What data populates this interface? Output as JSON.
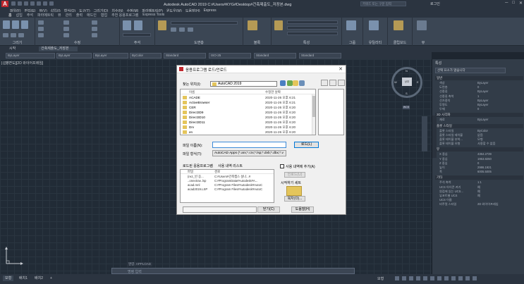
{
  "window": {
    "app_logo": "A",
    "title": "Autodesk AutoCAD 2019    C:#Users#KYG#Desktop#건축제출도_저장본.dwg",
    "search_placeholder": "키워드 또는 구문 입력",
    "user": "로그인",
    "controls": [
      "─",
      "□",
      "✕"
    ]
  },
  "menubar": {
    "items": [
      "파일(F)",
      "편집(E)",
      "뷰(V)",
      "삽입(I)",
      "형식(O)",
      "도구(T)",
      "그리기(D)",
      "치수(N)",
      "수정(M)",
      "파라메트릭(P)",
      "윈도우(W)",
      "도움말(H)",
      "Express"
    ]
  },
  "ribbon": {
    "tabs": [
      "홈",
      "삽입",
      "주석",
      "파라메트릭",
      "뷰",
      "관리",
      "출력",
      "애드인",
      "협업",
      "추천 응용프로그램",
      "Express Tools"
    ],
    "active_tab": "홈",
    "panels": [
      "그리기",
      "수정",
      "주석",
      "도면층",
      "블록",
      "특성",
      "그룹",
      "유틸리티",
      "클립보드",
      "뷰"
    ]
  },
  "file_tabs": {
    "start": "시작",
    "drawing": "건축제출도_저장본"
  },
  "prop_toolbar": {
    "layer": "ByLayer",
    "color": "ByLayer",
    "linetype": "ByLayer",
    "lineweight": "ByColor",
    "text_style": "Standard",
    "dim_style": "ISO-25",
    "table_style": "Standard",
    "mleader": "Standard"
  },
  "viewport": {
    "label": "[-][평면도][2D 와이어프레임]"
  },
  "viewcube": {
    "face": "상부",
    "north": "N",
    "south": "S",
    "east": "E",
    "west": "W",
    "wcs": "WCS"
  },
  "command": {
    "history": "명령: APPLOAD",
    "prompt": "명령 입력"
  },
  "status": {
    "tabs": [
      "모형",
      "배치1",
      "배치2",
      "+"
    ],
    "active": "모형",
    "mode": "모형"
  },
  "properties": {
    "title": "특성",
    "selection": "선택 요소가 없습니다",
    "sections": [
      {
        "name": "일반",
        "rows": [
          [
            "색상",
            "ByLayer"
          ],
          [
            "도면층",
            "0"
          ],
          [
            "선종류",
            "ByLayer"
          ],
          [
            "선종류 축척",
            "1"
          ],
          [
            "선가중치",
            "ByLayer"
          ],
          [
            "투명도",
            "ByLayer"
          ],
          [
            "두께",
            "0"
          ]
        ]
      },
      {
        "name": "3D 시각화",
        "rows": [
          [
            "재료",
            "ByLayer"
          ]
        ]
      },
      {
        "name": "플롯 스타일",
        "rows": [
          [
            "플롯 스타일",
            "ByColor"
          ],
          [
            "플롯 스타일 테이블",
            "없음"
          ],
          [
            "플롯 테이블 부착...",
            "모형"
          ],
          [
            "플롯 테이블 유형",
            "사용할 수 없음"
          ]
        ]
      },
      {
        "name": "뷰",
        "rows": [
          [
            "X 중심",
            "4364.2739"
          ],
          [
            "Y 중심",
            "1953.8250"
          ],
          [
            "Z 중심",
            "0"
          ],
          [
            "높이",
            "2986.1921"
          ],
          [
            "폭",
            "6005.5005"
          ]
        ]
      },
      {
        "name": "기타",
        "rows": [
          [
            "주석 축척",
            "1:1"
          ],
          [
            "UCS 아이콘 켜기",
            "예"
          ],
          [
            "원점에 있는 UCS...",
            "예"
          ],
          [
            "뷰포트별 UCS",
            "예"
          ],
          [
            "UCS 이름",
            ""
          ],
          [
            "비주얼 스타일",
            "2D 와이어프레임"
          ]
        ]
      }
    ]
  },
  "dialog": {
    "title": "응용프로그램 로드/언로드",
    "close": "✕",
    "lookin_label": "찾는 위치(I):",
    "lookin_value": "AutoCAD 2019",
    "col_name": "이름",
    "col_date": "수정한 날짜",
    "files": [
      [
        "ACADE",
        "2020-11-26 오후 6:21"
      ],
      [
        "ActiveBrowser",
        "2020-11-26 오후 6:21"
      ],
      [
        "CER",
        "2020-11-26 오후 6:20"
      ],
      [
        "Direct3D9",
        "2020-11-26 오후 6:20"
      ],
      [
        "Direct3D10",
        "2020-11-26 오후 6:20"
      ],
      [
        "Direct3D11",
        "2020-11-26 오후 6:20"
      ],
      [
        "Drv",
        "2020-11-26 오후 6:20"
      ],
      [
        "en",
        "2020-11-26 오후 6:20"
      ]
    ],
    "fname_label": "파일 이름(N):",
    "fname_value": "",
    "ftype_label": "파일 형식(T):",
    "ftype_value": "AutoCAD Apps (*.arx;*.crx;*.lsp;*.dvb;*.dbx;*.v",
    "load_btn": "로드(L)",
    "loaded_tab": "로드된 응용프로그램",
    "history_tab": "사용 내역 리스트",
    "add_history": "사용 내역에 추가(A)",
    "ll_col1": "파일",
    "ll_col2": "경로",
    "loaded": [
      [
        "(re2_빈 응...",
        "C:#Users#건축캡스 설나...#"
      ],
      [
        "..onextrav..lsp",
        "C:#ProgramData#Autodesk#A..."
      ],
      [
        "acad.mnl",
        "C:#Program Files#Autodesk#AutoC"
      ],
      [
        "acad2019.LSP",
        "C:#Program Files#Autodesk#AutoC"
      ]
    ],
    "remove_btn": "언로드(U)",
    "suite_label": "시작하기 세트",
    "contents_btn": "목차(O)...",
    "close_btn": "닫기(C)",
    "help_btn": "도움말(H)"
  }
}
